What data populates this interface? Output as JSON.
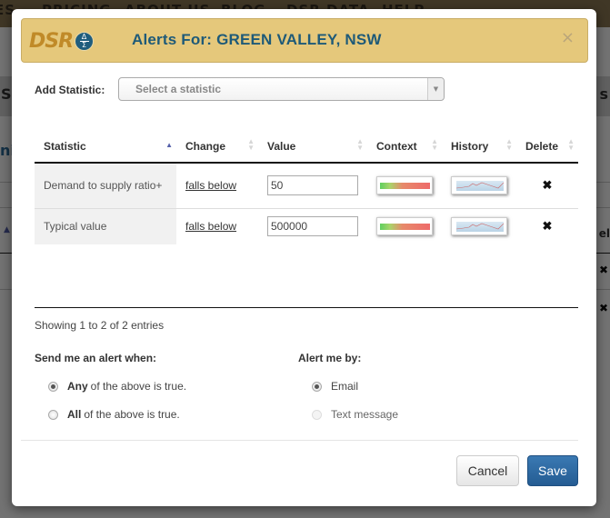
{
  "background": {
    "nav_items": [
      "ES",
      "PRICING",
      "ABOUT US",
      "BLOG",
      "DSR DATA",
      "HELP"
    ],
    "band_left": "S",
    "band_right": "s",
    "title_fragment": "ni",
    "right_header_fragment": "el"
  },
  "modal": {
    "logo": {
      "text": "DSR",
      "badge_top": "Δ",
      "badge_bottom": "Σ"
    },
    "title": "Alerts For: GREEN VALLEY, NSW",
    "close_icon": "×",
    "add_statistic": {
      "label": "Add Statistic:",
      "placeholder": "Select a statistic",
      "dropdown_icon": "▼"
    },
    "table": {
      "columns": [
        {
          "label": "Statistic",
          "sort": "asc"
        },
        {
          "label": "Change",
          "sort": "none"
        },
        {
          "label": "Value",
          "sort": "none"
        },
        {
          "label": "Context",
          "sort": "none"
        },
        {
          "label": "History",
          "sort": "none"
        },
        {
          "label": "Delete",
          "sort": "none"
        }
      ],
      "rows": [
        {
          "statistic": "Demand to supply ratio+",
          "change": "falls below",
          "value": "50",
          "delete_icon": "✖"
        },
        {
          "statistic": "Typical value",
          "change": "falls below",
          "value": "500000",
          "delete_icon": "✖"
        }
      ]
    },
    "showing": "Showing 1 to 2 of 2 entries",
    "alert_when": {
      "label": "Send me an alert when:",
      "options": [
        {
          "bold": "Any",
          "rest": "of the above is true.",
          "checked": true
        },
        {
          "bold": "All",
          "rest": "of the above is true.",
          "checked": false
        }
      ]
    },
    "alert_by": {
      "label": "Alert me by:",
      "options": [
        {
          "label": "Email",
          "checked": true,
          "disabled": false
        },
        {
          "label": "Text message",
          "checked": false,
          "disabled": true
        }
      ]
    },
    "buttons": {
      "cancel": "Cancel",
      "save": "Save"
    }
  },
  "colors": {
    "header_bg": "#e5c87b",
    "title_color": "#1e5a78",
    "save_bg": "#2d6aa3",
    "sort_active": "#5560aa"
  }
}
